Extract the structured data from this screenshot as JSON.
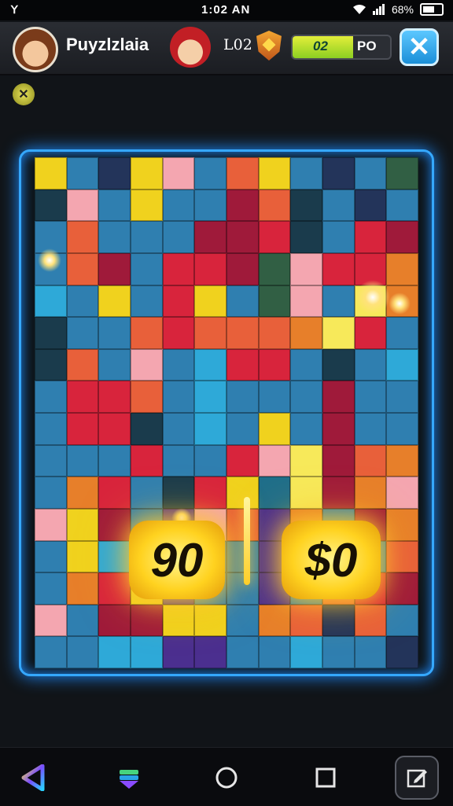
{
  "status_bar": {
    "left_glyph": "ꓬ",
    "time": "1:02 AN",
    "battery_text": "68%"
  },
  "header": {
    "title": "Puyzlzlaia",
    "level": "L02",
    "progress_text_a": "02",
    "progress_text_b": "PO",
    "progress_fraction": 0.62,
    "close_symbol": "✕"
  },
  "side_button_symbol": "✕",
  "board": {
    "palette": [
      "#f0d21e",
      "#2f7fb0",
      "#d8243c",
      "#e8603a",
      "#23345a",
      "#f4a6b0",
      "#1f6e8a",
      "#9f1a3a",
      "#f7e95a",
      "#4b2f8f",
      "#2ea9d8",
      "#315f44",
      "#e77f2a",
      "#6a1f6e",
      "#1a3b4c"
    ],
    "cells": [
      0,
      1,
      4,
      0,
      5,
      1,
      3,
      0,
      1,
      4,
      1,
      11,
      14,
      5,
      1,
      0,
      1,
      1,
      7,
      3,
      14,
      1,
      4,
      1,
      1,
      3,
      1,
      1,
      1,
      7,
      7,
      2,
      14,
      1,
      2,
      7,
      1,
      3,
      7,
      1,
      2,
      2,
      7,
      11,
      5,
      2,
      2,
      12,
      10,
      1,
      0,
      1,
      2,
      0,
      1,
      11,
      5,
      1,
      8,
      12,
      14,
      1,
      1,
      3,
      2,
      3,
      3,
      3,
      12,
      8,
      2,
      1,
      14,
      3,
      1,
      5,
      1,
      10,
      2,
      2,
      1,
      14,
      1,
      10,
      1,
      2,
      2,
      3,
      1,
      10,
      1,
      1,
      1,
      7,
      1,
      1,
      1,
      2,
      2,
      14,
      1,
      10,
      1,
      0,
      1,
      7,
      1,
      1,
      1,
      1,
      1,
      2,
      1,
      1,
      2,
      5,
      8,
      7,
      3,
      12,
      1,
      12,
      2,
      1,
      14,
      2,
      0,
      6,
      8,
      7,
      12,
      5,
      5,
      0,
      7,
      1,
      9,
      5,
      3,
      9,
      12,
      1,
      7,
      12,
      1,
      0,
      10,
      4,
      9,
      1,
      1,
      9,
      3,
      14,
      1,
      3,
      1,
      12,
      2,
      0,
      9,
      1,
      1,
      9,
      1,
      3,
      2,
      7,
      5,
      1,
      7,
      7,
      0,
      0,
      1,
      12,
      3,
      4,
      3,
      1,
      1,
      1,
      10,
      10,
      9,
      9,
      1,
      1,
      10,
      1,
      1,
      4
    ]
  },
  "scores": {
    "left": "90",
    "right": "$0"
  },
  "nav": {
    "back_icon": "back-triangle-icon",
    "layers_icon": "layers-icon",
    "home_icon": "home-circle-icon",
    "recents_icon": "recents-square-icon",
    "edit_icon": "edit-icon"
  }
}
